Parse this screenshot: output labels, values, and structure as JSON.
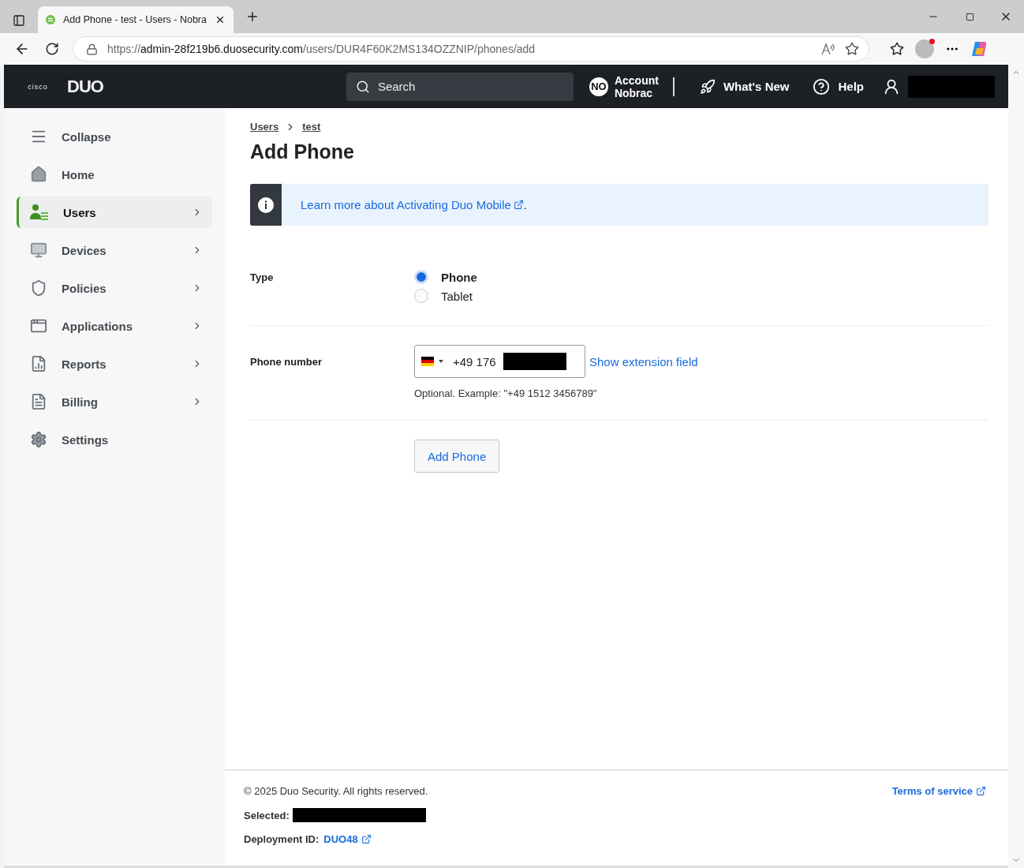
{
  "browser": {
    "tab_title": "Add Phone - test - Users - Nobra",
    "url_scheme": "https://",
    "url_host": "admin-28f219b6.duosecurity.com",
    "url_path": "/users/DUR4F60K2MS134OZZNIP/phones/add"
  },
  "header": {
    "brand": "cisco",
    "logo": "DUO",
    "search_placeholder": "Search",
    "account_badge": "NO",
    "account_label": "Account",
    "account_name": "Nobrac",
    "whats_new": "What's New",
    "help": "Help"
  },
  "sidebar": {
    "items": [
      {
        "label": "Collapse",
        "selected": false,
        "has_submenu": false
      },
      {
        "label": "Home",
        "selected": false,
        "has_submenu": false
      },
      {
        "label": "Users",
        "selected": true,
        "has_submenu": true
      },
      {
        "label": "Devices",
        "selected": false,
        "has_submenu": true
      },
      {
        "label": "Policies",
        "selected": false,
        "has_submenu": true
      },
      {
        "label": "Applications",
        "selected": false,
        "has_submenu": true
      },
      {
        "label": "Reports",
        "selected": false,
        "has_submenu": true
      },
      {
        "label": "Billing",
        "selected": false,
        "has_submenu": true
      },
      {
        "label": "Settings",
        "selected": false,
        "has_submenu": false
      }
    ]
  },
  "breadcrumbs": [
    "Users",
    "test"
  ],
  "title": "Add Phone",
  "info_banner": {
    "link": "Learn more about Activating Duo Mobile",
    "suffix": "."
  },
  "form": {
    "type_label": "Type",
    "type_options": [
      {
        "label": "Phone",
        "selected": true
      },
      {
        "label": "Tablet",
        "selected": false
      }
    ],
    "phone_label": "Phone number",
    "phone_value": "+49 176",
    "extension_link": "Show extension field",
    "hint": "Optional. Example: \"+49 1512 3456789\"",
    "submit": "Add Phone"
  },
  "footer": {
    "copyright": "© 2025 Duo Security. All rights reserved.",
    "terms": "Terms of service",
    "selected_label": "Selected:",
    "deployment_label": "Deployment ID:",
    "deployment_id": "DUO48"
  }
}
